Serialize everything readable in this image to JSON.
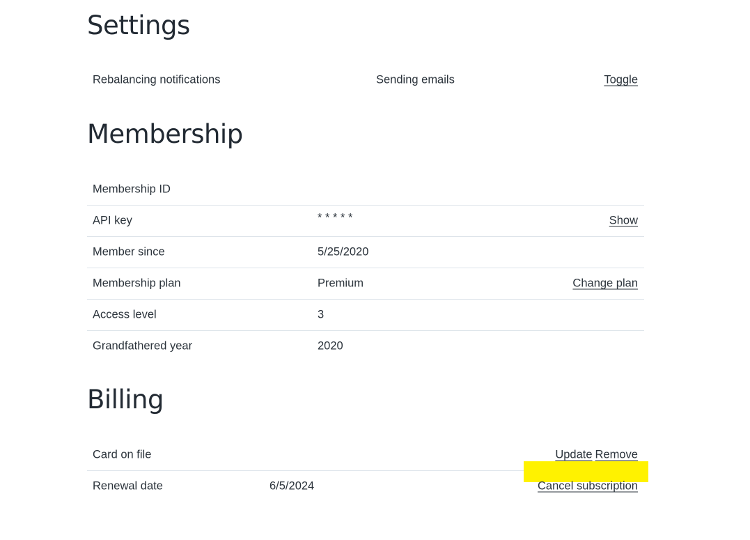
{
  "settings": {
    "title": "Settings",
    "rows": [
      {
        "label": "Rebalancing notifications",
        "value": "Sending emails",
        "action": "Toggle"
      }
    ]
  },
  "membership": {
    "title": "Membership",
    "rows": [
      {
        "label": "Membership ID",
        "value": ""
      },
      {
        "label": "API key",
        "value": "* * * * *",
        "action": "Show"
      },
      {
        "label": "Member since",
        "value": "5/25/2020"
      },
      {
        "label": "Membership plan",
        "value": "Premium",
        "action": "Change plan"
      },
      {
        "label": "Access level",
        "value": "3"
      },
      {
        "label": "Grandfathered year",
        "value": "2020"
      }
    ]
  },
  "billing": {
    "title": "Billing",
    "rows": [
      {
        "label": "Card on file",
        "value": "",
        "actions": [
          "Update",
          "Remove"
        ]
      },
      {
        "label": "Renewal date",
        "value": "6/5/2024",
        "action": "Cancel subscription"
      }
    ]
  },
  "colors": {
    "highlight": "#fff200",
    "divider": "#dde4ea",
    "text": "#2b333b"
  }
}
